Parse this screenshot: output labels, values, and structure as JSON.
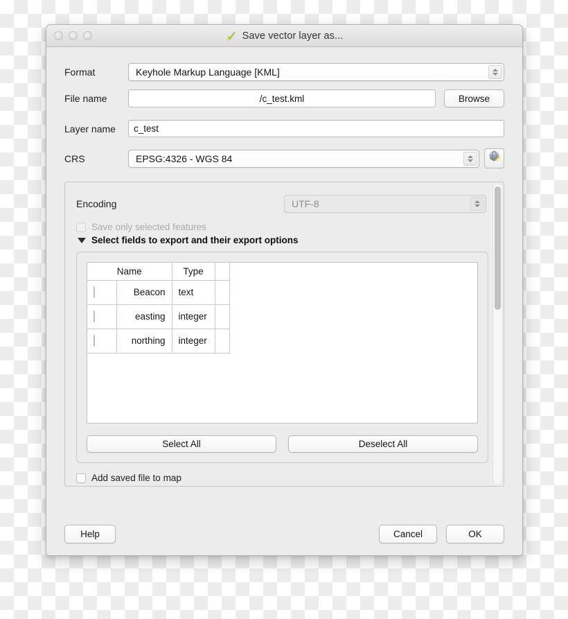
{
  "window": {
    "title": "Save vector layer as...",
    "title_icon": "qgis-pencil-icon",
    "traffic_lights": [
      "close-button",
      "minimize-button",
      "zoom-button"
    ]
  },
  "form": {
    "format": {
      "label": "Format",
      "value": "Keyhole Markup Language [KML]"
    },
    "file_name": {
      "label": "File name",
      "value": "/c_test.kml",
      "browse_label": "Browse"
    },
    "layer_name": {
      "label": "Layer name",
      "value": "c_test"
    },
    "crs": {
      "label": "CRS",
      "value": "EPSG:4326 - WGS 84",
      "select_icon": "globe-pencil-icon"
    }
  },
  "options": {
    "encoding": {
      "label": "Encoding",
      "value": "UTF-8",
      "disabled": true
    },
    "save_only_selected": {
      "label": "Save only selected features",
      "checked": false,
      "disabled": true
    },
    "select_fields": {
      "label": "Select fields to export and their export options",
      "expanded": true
    },
    "add_saved_file": {
      "label": "Add saved file to map",
      "checked": false
    }
  },
  "fields_table": {
    "columns": [
      "Name",
      "Type"
    ],
    "rows": [
      {
        "checked": false,
        "name": "Beacon",
        "type": "text"
      },
      {
        "checked": false,
        "name": "easting",
        "type": "integer"
      },
      {
        "checked": false,
        "name": "northing",
        "type": "integer"
      }
    ],
    "select_all_label": "Select All",
    "deselect_all_label": "Deselect All"
  },
  "footer": {
    "help_label": "Help",
    "cancel_label": "Cancel",
    "ok_label": "OK"
  },
  "colors": {
    "window_bg": "#ececec",
    "title_text": "#343434",
    "disabled_text": "#aaaaaa",
    "field_bg": "#ffffff",
    "accent_green": "#7cb342",
    "accent_yellow": "#f2c94c"
  }
}
